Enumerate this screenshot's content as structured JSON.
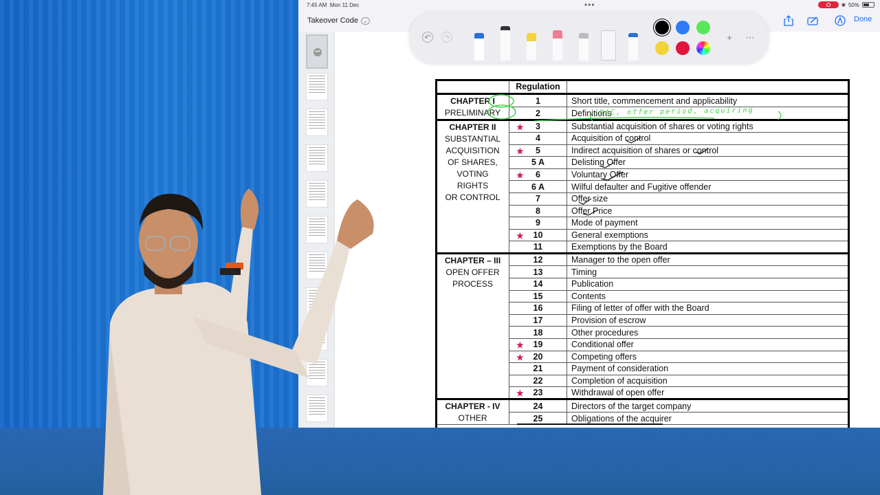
{
  "status": {
    "time": "7:45 AM",
    "date": "Mon 11 Dec",
    "battery": "50%"
  },
  "nav": {
    "title": "Takeover Code",
    "done": "Done"
  },
  "toolbar": {
    "colors": [
      "#000000",
      "#2f7cf6",
      "#57e85a",
      "#f2d43a",
      "#e0143c",
      "rainbow"
    ],
    "tools": [
      "pen-tool",
      "monoline-tool",
      "highlighter-tool",
      "eraser-tool",
      "pencil-tool",
      "ruler-tool",
      "fountain-pen-tool"
    ]
  },
  "table": {
    "header": {
      "regulation": "Regulation"
    },
    "chapters": [
      {
        "lines": [
          "CHAPTER I",
          "PRELIMINARY"
        ],
        "rows": [
          {
            "no": "1",
            "title": "Short title, commencement and applicability",
            "star": false
          },
          {
            "no": "2",
            "title": "Definitions",
            "star": false
          }
        ]
      },
      {
        "lines": [
          "CHAPTER II",
          "SUBSTANTIAL",
          "ACQUISITION",
          "OF SHARES,",
          "VOTING RIGHTS",
          "OR CONTROL"
        ],
        "rows": [
          {
            "no": "3",
            "title": "Substantial acquisition of shares or voting rights",
            "star": true
          },
          {
            "no": "4",
            "title": "Acquisition of control",
            "star": false
          },
          {
            "no": "5",
            "title": "Indirect acquisition of shares or control",
            "star": true
          },
          {
            "no": "5 A",
            "title": "Delisting Offer",
            "star": false
          },
          {
            "no": "6",
            "title": "Voluntary Offer",
            "star": true
          },
          {
            "no": "6 A",
            "title": "Wilful defaulter and Fugitive offender",
            "star": false
          },
          {
            "no": "7",
            "title": "Offer size",
            "star": false
          },
          {
            "no": "8",
            "title": "Offer Price",
            "star": false
          },
          {
            "no": "9",
            "title": "Mode of payment",
            "star": false
          },
          {
            "no": "10",
            "title": "General exemptions",
            "star": true
          },
          {
            "no": "11",
            "title": "Exemptions by the Board",
            "star": false
          }
        ]
      },
      {
        "lines": [
          "CHAPTER – III",
          "OPEN OFFER",
          "PROCESS"
        ],
        "rows": [
          {
            "no": "12",
            "title": "Manager to the open offer",
            "star": false
          },
          {
            "no": "13",
            "title": "Timing",
            "star": false
          },
          {
            "no": "14",
            "title": "Publication",
            "star": false
          },
          {
            "no": "15",
            "title": "Contents",
            "star": false
          },
          {
            "no": "16",
            "title": "Filing of letter of offer with the Board",
            "star": false
          },
          {
            "no": "17",
            "title": "Provision of escrow",
            "star": false
          },
          {
            "no": "18",
            "title": "Other procedures",
            "star": false
          },
          {
            "no": "19",
            "title": "Conditional offer",
            "star": true
          },
          {
            "no": "20",
            "title": "Competing offers",
            "star": true
          },
          {
            "no": "21",
            "title": "Payment of consideration",
            "star": false
          },
          {
            "no": "22",
            "title": "Completion of acquisition",
            "star": false
          },
          {
            "no": "23",
            "title": "Withdrawal of open offer",
            "star": true
          }
        ]
      },
      {
        "lines": [
          "CHAPTER - IV",
          "OTHER"
        ],
        "rows": [
          {
            "no": "24",
            "title": "Directors of the target company",
            "star": false
          },
          {
            "no": "25",
            "title": "Obligations of the acquirer",
            "star": false
          }
        ]
      }
    ]
  },
  "annotation": {
    "definitions_note": "PAC, offer period, acquiring"
  }
}
